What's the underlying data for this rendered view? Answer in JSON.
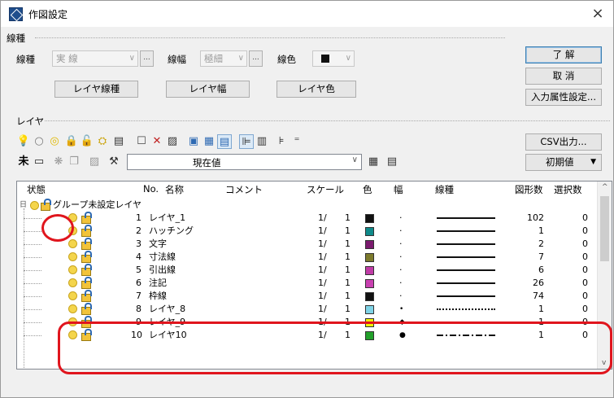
{
  "window": {
    "title": "作図設定",
    "close": "×"
  },
  "line_group": {
    "label": "線種",
    "type_label": "線種",
    "type_value": "実 線",
    "width_label": "線幅",
    "width_value": "極細",
    "color_label": "線色",
    "more": "...",
    "layer_type_btn": "レイヤ線種",
    "layer_width_btn": "レイヤ幅",
    "layer_color_btn": "レイヤ色"
  },
  "side_buttons": {
    "ok": "了 解",
    "cancel": "取 消",
    "input_attr": "入力属性設定...",
    "csv": "CSV出力...",
    "initial": "初期値"
  },
  "layer_group": {
    "label": "レイヤ",
    "current_value": "現在値",
    "toolbar_row1": [
      "bulb-icon",
      "bulb-outline-icon",
      "bulb-pair-icon",
      "lock-icon",
      "unlock-icon",
      "lock-group-icon",
      "layer-list-icon",
      "new-layer-icon",
      "delete-icon",
      "properties-icon",
      "view-mode-1-icon",
      "view-mode-2-icon",
      "view-mode-3-icon",
      "tree-view-icon",
      "flat-view-icon",
      "expand-icon",
      "collapse-icon"
    ],
    "toolbar_row2_label": "未",
    "toolbar_row2": [
      "save-icon",
      "merge-icon",
      "copy-icon",
      "import-icon",
      "pick-icon",
      "settings-icon",
      "export-icon"
    ]
  },
  "grid": {
    "headers": {
      "status": "状態",
      "no": "No.",
      "name": "名称",
      "comment": "コメント",
      "scale": "スケール",
      "color": "色",
      "width": "幅",
      "linetype": "線種",
      "shapes": "図形数",
      "selected": "選択数"
    },
    "group_row": {
      "toggle": "日",
      "name": "グループ未設定レイヤ"
    },
    "rows": [
      {
        "no": "1",
        "name": "レイヤ_1",
        "scale_a": "1/",
        "scale_b": "1",
        "color": "#111111",
        "width": "·",
        "linetype": "solid",
        "shapes": "102",
        "selected": "0"
      },
      {
        "no": "2",
        "name": "ハッチング",
        "scale_a": "1/",
        "scale_b": "1",
        "color": "#0f8a8a",
        "width": "·",
        "linetype": "solid",
        "shapes": "1",
        "selected": "0"
      },
      {
        "no": "3",
        "name": "文字",
        "scale_a": "1/",
        "scale_b": "1",
        "color": "#7a1a6e",
        "width": "·",
        "linetype": "solid",
        "shapes": "2",
        "selected": "0"
      },
      {
        "no": "4",
        "name": "寸法線",
        "scale_a": "1/",
        "scale_b": "1",
        "color": "#7c7a2c",
        "width": "·",
        "linetype": "solid",
        "shapes": "7",
        "selected": "0"
      },
      {
        "no": "5",
        "name": "引出線",
        "scale_a": "1/",
        "scale_b": "1",
        "color": "#c03ca6",
        "width": "·",
        "linetype": "solid",
        "shapes": "6",
        "selected": "0"
      },
      {
        "no": "6",
        "name": "注記",
        "scale_a": "1/",
        "scale_b": "1",
        "color": "#c840b0",
        "width": "·",
        "linetype": "solid",
        "shapes": "26",
        "selected": "0"
      },
      {
        "no": "7",
        "name": "枠線",
        "scale_a": "1/",
        "scale_b": "1",
        "color": "#111111",
        "width": "·",
        "linetype": "solid",
        "shapes": "74",
        "selected": "0"
      },
      {
        "no": "8",
        "name": "レイヤ_8",
        "scale_a": "1/",
        "scale_b": "1",
        "color": "#7fd3e6",
        "width": "•",
        "linetype": "dotted",
        "shapes": "1",
        "selected": "0"
      },
      {
        "no": "9",
        "name": "レイヤ_9",
        "scale_a": "1/",
        "scale_b": "1",
        "color": "#f0f000",
        "width": "◆",
        "linetype": "dashed",
        "shapes": "1",
        "selected": "0"
      },
      {
        "no": "10",
        "name": "レイヤ10",
        "scale_a": "1/",
        "scale_b": "1",
        "color": "#22a02a",
        "width": "●",
        "linetype": "dashdot",
        "shapes": "1",
        "selected": "0"
      }
    ]
  },
  "colors": {
    "highlight": "#e0151d",
    "accent": "#3c7fb1"
  }
}
